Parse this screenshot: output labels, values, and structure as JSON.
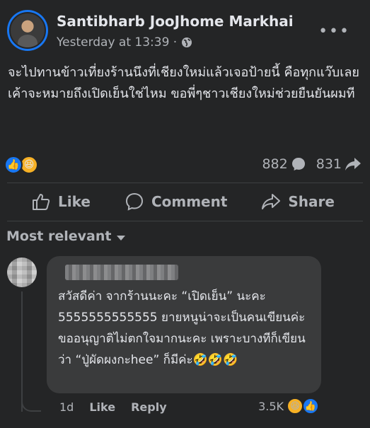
{
  "post": {
    "author": "Santibharb JooJhome Markhai",
    "timestamp": "Yesterday at 13:39 ·",
    "text": "จะไปทานข้าวเที่ยงร้านนึงที่เชียงใหม่แล้วเจอป้ายนี้ คือทุกแว๊บเลย เค้าจะหมายถึงเปิดเย็นใช่ไหม ขอพี่ๆชาวเชียงใหม่ช่วยยืนยันผมที",
    "more_label": "•••"
  },
  "reactions": {
    "like_icon": "👍",
    "haha_icon": "😆",
    "comments_count": "882",
    "shares_count": "831"
  },
  "actions": {
    "like": "Like",
    "comment": "Comment",
    "share": "Share"
  },
  "comments_filter": "Most relevant",
  "comment": {
    "text": "สวัสดีค่า จากร้านนะคะ “เปิดเย็น” นะคะ 5555555555555 ยายหนูน่าจะเป็นคนเขียนค่ะ ขออนุญาติไม่ตกใจมากนะคะ เพราะบางทีก็เขียนว่า “ปู่ผัดผงกะhee” ก็มีค่ะ🤣🤣🤣",
    "time": "1d",
    "like_label": "Like",
    "reply_label": "Reply",
    "reaction_count": "3.5K",
    "haha_icon": "😆",
    "like_icon": "👍"
  },
  "colors": {
    "background": "#242526",
    "bubble": "#3a3b3c",
    "accent": "#1877f2",
    "muted_text": "#b0b3b8"
  }
}
